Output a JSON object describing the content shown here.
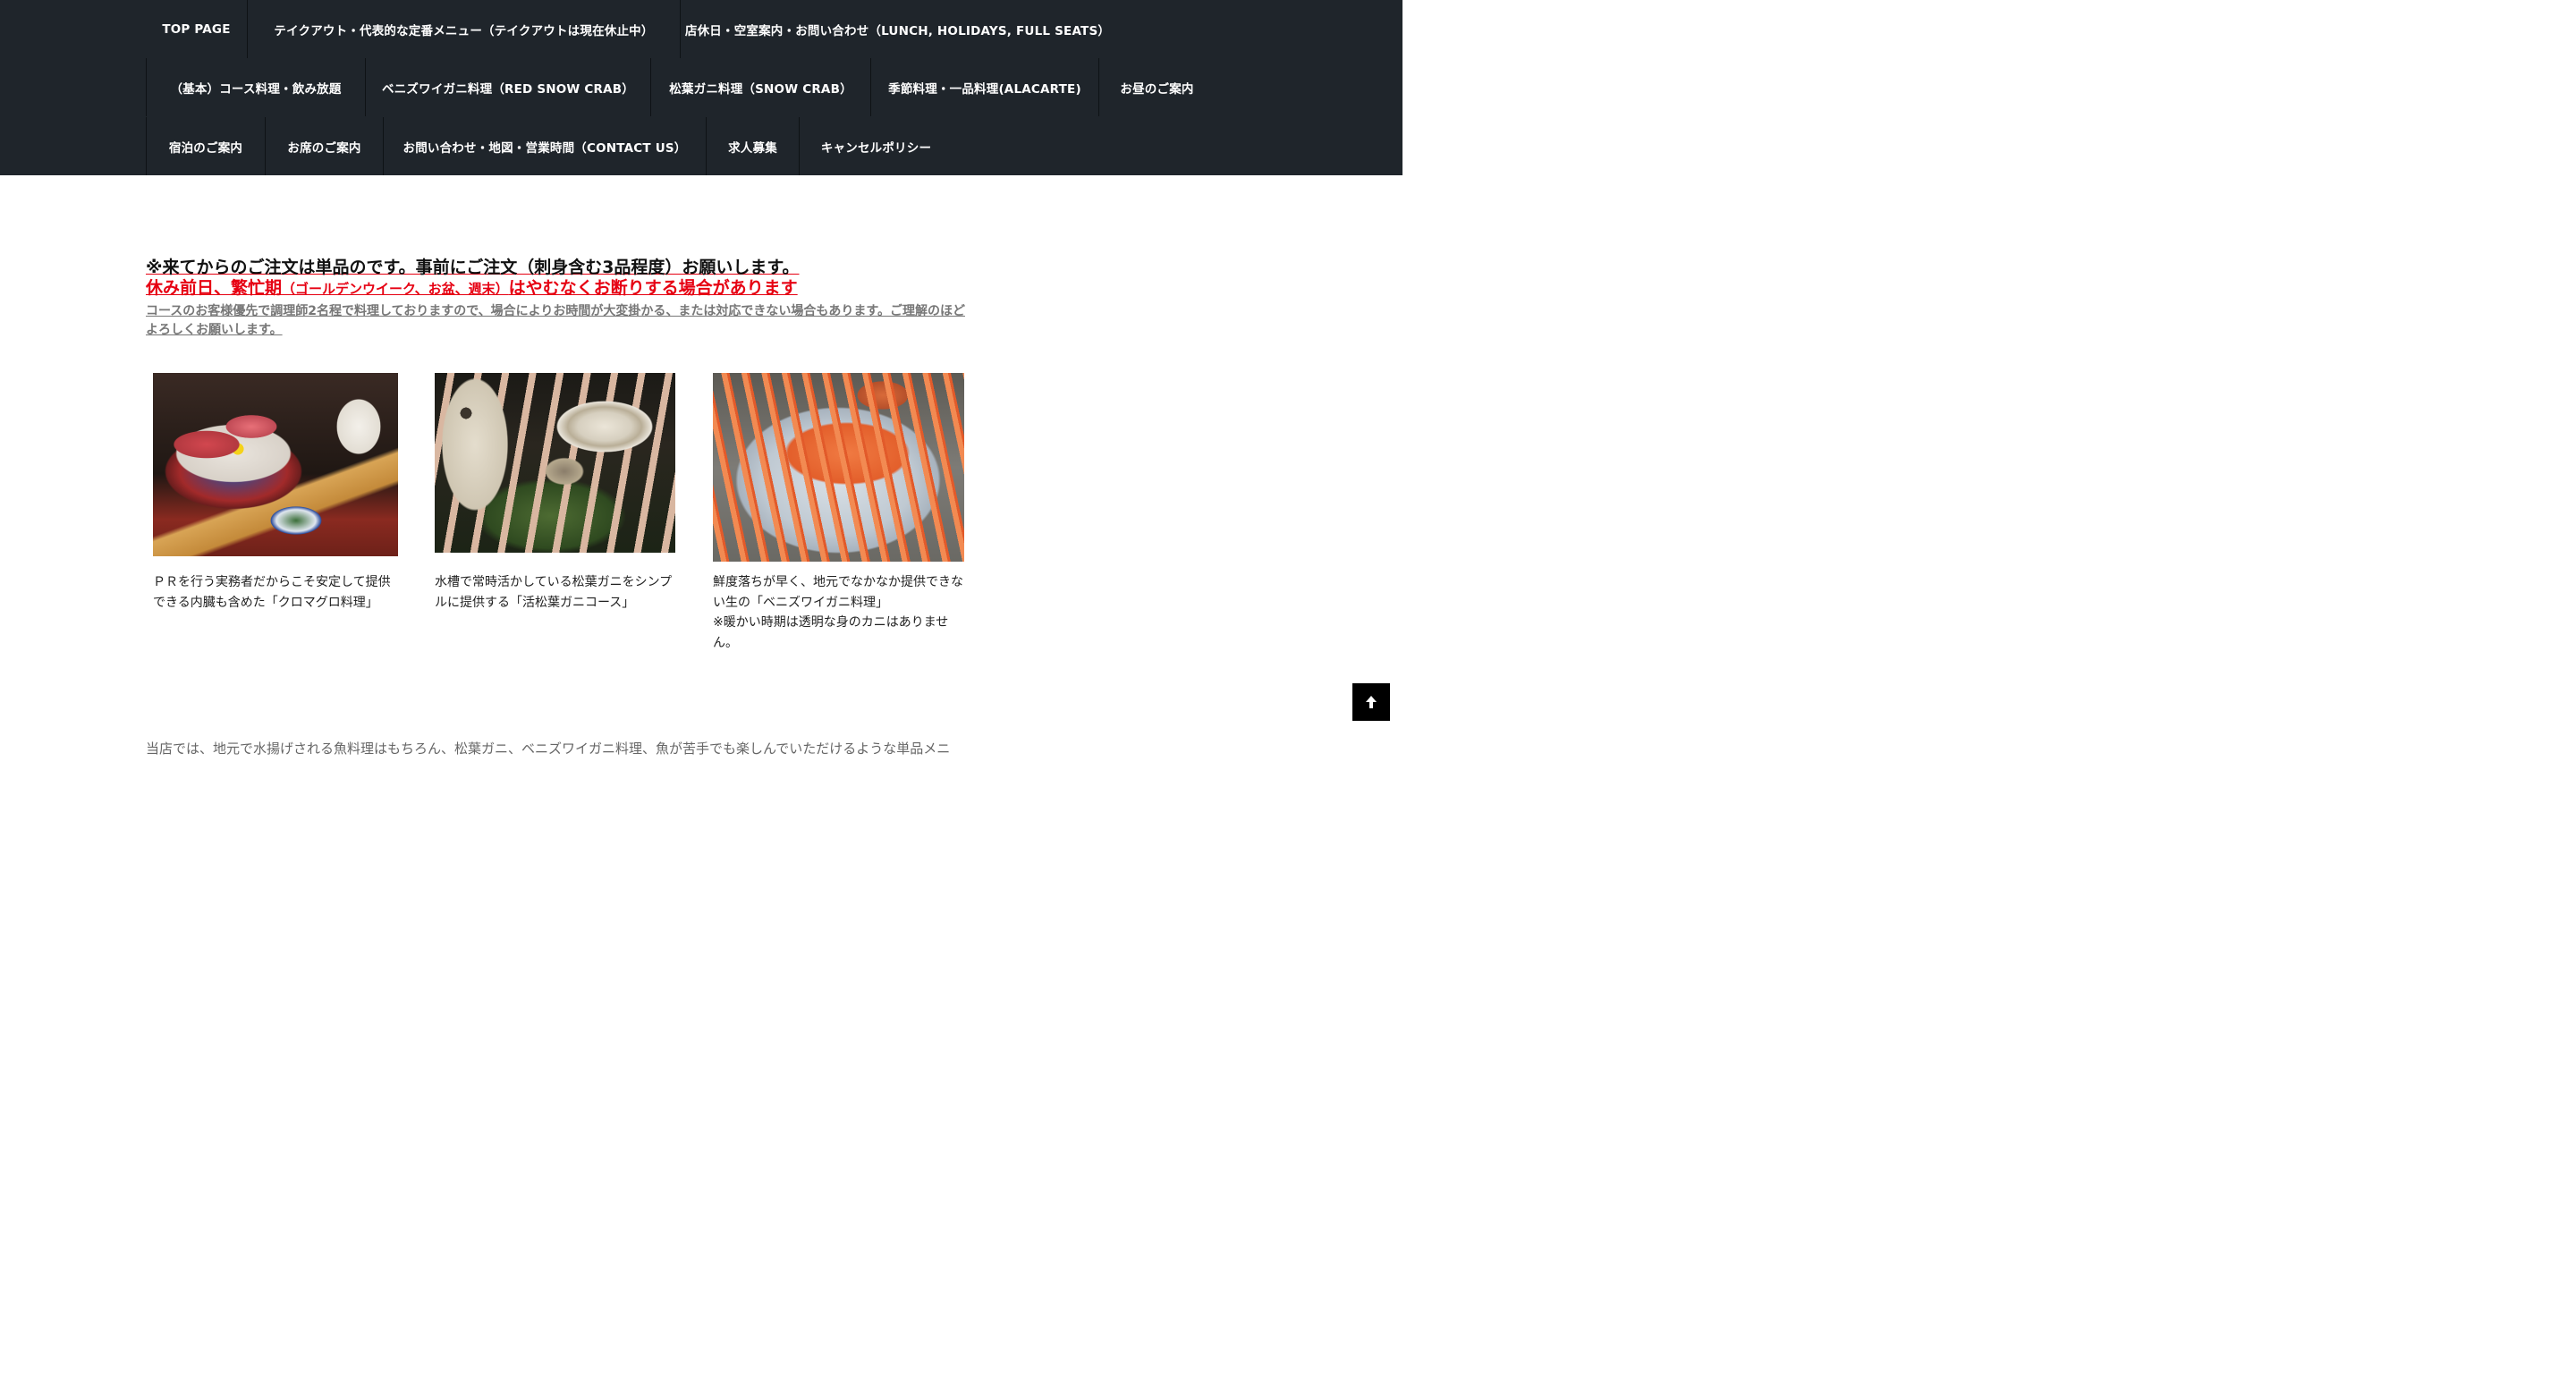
{
  "nav": {
    "row1": [
      "TOP PAGE",
      "テイクアウト・代表的な定番メニュー（テイクアウトは現在休止中）",
      "店休日・空室案内・お問い合わせ（LUNCH, HOLIDAYS, FULL SEATS）"
    ],
    "row2": [
      "（基本）コース料理・飲み放題",
      "ベニズワイガニ料理（RED SNOW CRAB）",
      "松葉ガニ料理（SNOW CRAB）",
      "季節料理・一品料理(ALACARTE)",
      "お昼のご案内"
    ],
    "row3": [
      "宿泊のご案内",
      "お席のご案内",
      "お問い合わせ・地図・営業時間（CONTACT US）",
      "求人募集",
      "キャンセルポリシー"
    ]
  },
  "notice": {
    "line1": "※来てからのご注文は単品のです。事前にご注文（刺身含む3品程度）お願いします。",
    "line2_a": "休み前日、繁忙期",
    "line2_b": "（ゴールデンウイーク、お盆、週末）",
    "line2_c": "はやむなくお断りする場合があります",
    "line3": "コースのお客様優先で調理師2名程で料理しておりますので、場合によりお時間が大変掛かる、または対応できない場合もあります。ご理解のほどよろしくお願いします。"
  },
  "cards": [
    {
      "caption": "ＰＲを行う実務者だからこそ安定して提供できる内臓も含めた「クロマグロ料理」"
    },
    {
      "caption": "水槽で常時活かしている松葉ガニをシンプルに提供する「活松葉ガニコース」"
    },
    {
      "caption": "鮮度落ちが早く、地元でなかなか提供できない生の「ベニズワイガニ料理」",
      "caption2": "※暖かい時期は透明な身のカニはありません。"
    }
  ],
  "intro": "当店では、地元で水揚げされる魚料理はもちろん、松葉ガニ、ベニズワイガニ料理、魚が苦手でも楽しんでいただけるような単品メニ",
  "back_to_top": {
    "icon": "arrow-up-icon"
  }
}
